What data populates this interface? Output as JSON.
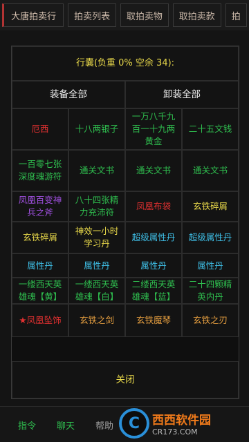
{
  "tabs": [
    "大唐拍卖行",
    "拍卖列表",
    "取拍卖物",
    "取拍卖款",
    "拍"
  ],
  "modal": {
    "title": "行囊(负重 0% 空余 34):",
    "equip_all": "装备全部",
    "unequip_all": "卸装全部",
    "close": "关闭",
    "items": [
      {
        "text": "厄西",
        "color": "#e03030"
      },
      {
        "text": "十八两银子",
        "color": "#2fbf4f"
      },
      {
        "text": "一万八千九百一十九两黄金",
        "color": "#2fbf4f"
      },
      {
        "text": "二十五文钱",
        "color": "#2fbf4f"
      },
      {
        "text": "一百零七张深度魂游符",
        "color": "#2fbf4f"
      },
      {
        "text": "通关文书",
        "color": "#2fbf4f"
      },
      {
        "text": "通关文书",
        "color": "#2fbf4f"
      },
      {
        "text": "通关文书",
        "color": "#2fbf4f"
      },
      {
        "text": "凤凰百变神兵之斧",
        "color": "#a050e0"
      },
      {
        "text": "八十四张精力充沛符",
        "color": "#2fbf4f"
      },
      {
        "text": "凤凰布袋",
        "color": "#e03030"
      },
      {
        "text": "玄铁碎屑",
        "color": "#e8d84a"
      },
      {
        "text": "玄铁碎屑",
        "color": "#e8d84a"
      },
      {
        "text": "神效一小时学习丹",
        "color": "#e8d84a"
      },
      {
        "text": "超级属性丹",
        "color": "#3fc0e8"
      },
      {
        "text": "超级属性丹",
        "color": "#3fc0e8"
      },
      {
        "text": "属性丹",
        "color": "#3fc0e8"
      },
      {
        "text": "属性丹",
        "color": "#3fc0e8"
      },
      {
        "text": "属性丹",
        "color": "#3fc0e8"
      },
      {
        "text": "属性丹",
        "color": "#3fc0e8"
      },
      {
        "text": "一缕西天英雄魂【黄】",
        "color": "#2fbf4f"
      },
      {
        "text": "一缕西天英雄魂【白】",
        "color": "#2fbf4f"
      },
      {
        "text": "二缕西天英雄魂【蓝】",
        "color": "#2fbf4f"
      },
      {
        "text": "二十四颗精英内丹",
        "color": "#2fbf4f"
      },
      {
        "text": "★凤凰坠饰",
        "color": "#e03030"
      },
      {
        "text": "玄铁之剑",
        "color": "#e8a040"
      },
      {
        "text": "玄铁魔琴",
        "color": "#e8a040"
      },
      {
        "text": "玄铁之刃",
        "color": "#e8a040"
      }
    ]
  },
  "bottom_nav": [
    "指令",
    "聊天",
    "帮助"
  ],
  "watermark": {
    "logo": "C",
    "main": "西西软件园",
    "sub": "CR173.COM"
  }
}
